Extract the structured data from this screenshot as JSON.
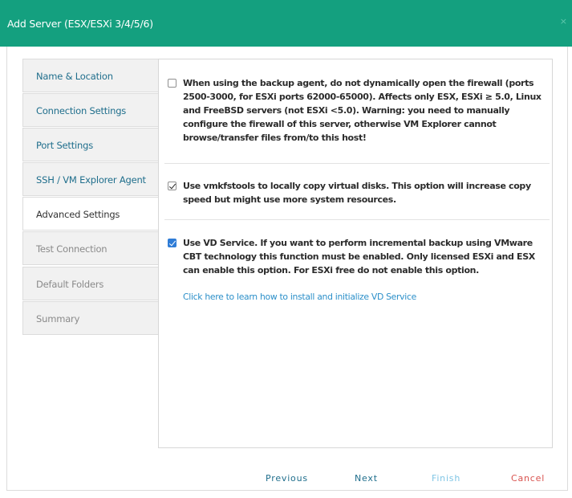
{
  "dialog": {
    "title": "Add Server (ESX/ESXi 3/4/5/6)",
    "close_glyph": "×"
  },
  "sidebar": {
    "items": [
      {
        "label": "Name & Location",
        "state": "link"
      },
      {
        "label": "Connection Settings",
        "state": "link"
      },
      {
        "label": "Port Settings",
        "state": "link"
      },
      {
        "label": "SSH / VM Explorer Agent",
        "state": "link"
      },
      {
        "label": "Advanced Settings",
        "state": "active"
      },
      {
        "label": "Test Connection",
        "state": "disabled"
      },
      {
        "label": "Default Folders",
        "state": "disabled"
      },
      {
        "label": "Summary",
        "state": "disabled"
      }
    ]
  },
  "options": [
    {
      "checked": false,
      "text": "When using the backup agent, do not dynamically open the firewall (ports 2500-3000, for ESXi ports 62000-65000). Affects only ESX, ESXi ≥ 5.0, Linux and FreeBSD servers (not ESXi <5.0). Warning: you need to manually configure the firewall of this server, otherwise VM Explorer cannot browse/transfer files from/to this host!"
    },
    {
      "checked": true,
      "text": "Use vmkfstools to locally copy virtual disks. This option will increase copy speed but might use more system resources."
    },
    {
      "checked": true,
      "text": "Use VD Service. If you want to perform incremental backup using VMware CBT technology this function must be enabled. Only licensed ESXi and ESX can enable this option. For ESXi free do not enable this option."
    }
  ],
  "vd_link": "Click here to learn how to install and initialize VD Service",
  "footer": {
    "previous": "Previous",
    "next": "Next",
    "finish": "Finish",
    "cancel": "Cancel"
  },
  "colors": {
    "title_bar": "#14a07f",
    "link": "#2b8fc9",
    "cancel": "#d9534f",
    "checkbox_checked": "#2f7cd6"
  }
}
